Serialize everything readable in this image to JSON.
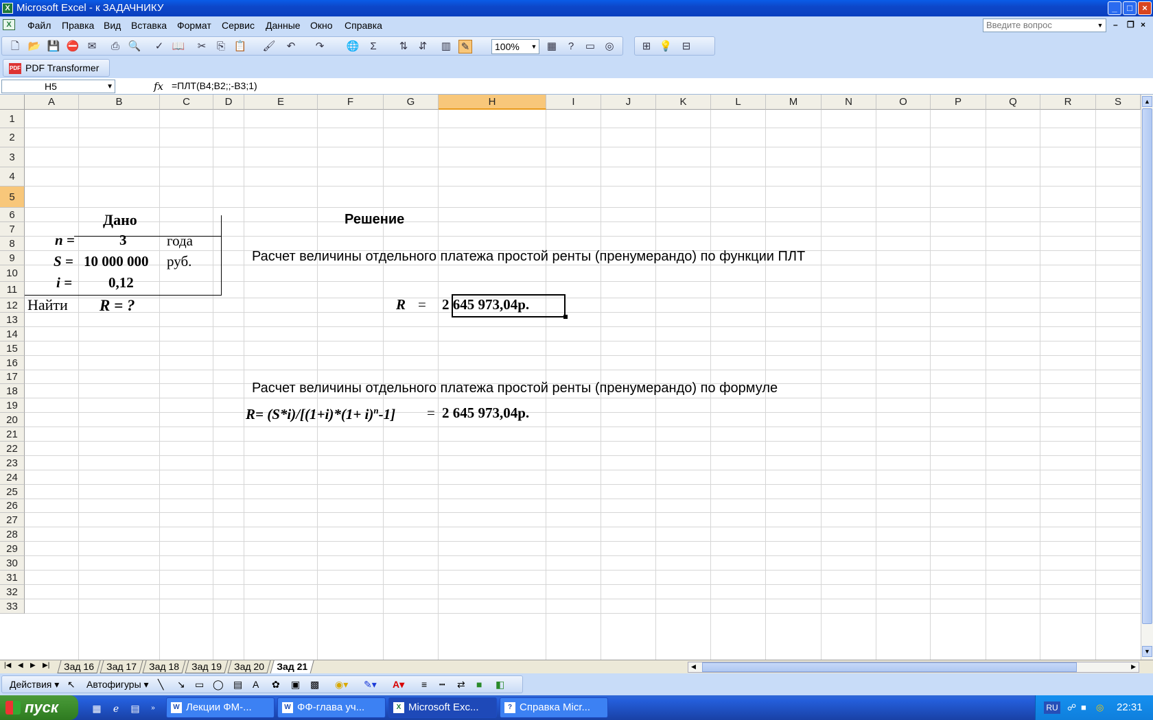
{
  "window": {
    "title": "Microsoft Excel - к ЗАДАЧНИКУ",
    "app_icon": "X"
  },
  "menu": {
    "items": [
      "Файл",
      "Правка",
      "Вид",
      "Вставка",
      "Формат",
      "Сервис",
      "Данные",
      "Окно",
      "Справка"
    ],
    "help_placeholder": "Введите вопрос"
  },
  "toolbar": {
    "zoom": "100%"
  },
  "pdf_toolbar": {
    "label": "PDF Transformer",
    "icon_text": "PDF"
  },
  "formula_bar": {
    "name_box": "H5",
    "fx": "fx",
    "formula": "=ПЛТ(B4;B2;;-B3;1)"
  },
  "grid": {
    "columns": [
      "A",
      "B",
      "C",
      "D",
      "E",
      "F",
      "G",
      "H",
      "I",
      "J",
      "K",
      "L",
      "M",
      "N",
      "O",
      "P",
      "Q",
      "R",
      "S"
    ],
    "rows": [
      "1",
      "2",
      "3",
      "4",
      "5",
      "6",
      "7",
      "8",
      "9",
      "10",
      "11",
      "12",
      "13",
      "14",
      "15",
      "16",
      "17",
      "18",
      "19",
      "20",
      "21",
      "22",
      "23",
      "24",
      "25",
      "26",
      "27",
      "28",
      "29",
      "30",
      "31",
      "32",
      "33"
    ],
    "selected_column": "H",
    "selected_row": "5"
  },
  "cells": {
    "given_title": "Дано",
    "n_label": "n =",
    "n_value": "3",
    "n_unit": "года",
    "s_label": "S =",
    "s_value": "10 000 000",
    "s_unit": "руб.",
    "i_label": "i =",
    "i_value": "0,12",
    "find_label": "Найти",
    "find_value": "R = ?",
    "solution_title": "Решение",
    "calc_plt_text": "Расчет величины отдельного платежа простой ренты (пренумерандо) по функции ПЛТ",
    "r_label": "R",
    "r_eq": "=",
    "r_value": "2 645 973,04р.",
    "calc_formula_text": "Расчет величины отдельного платежа простой ренты (пренумерандо) по формуле",
    "formula_text": "R= (S*i)/[(1+i)*(1+ i)",
    "formula_sup": "n",
    "formula_tail": "-1]",
    "formula_eq": "=",
    "formula_value": "2 645 973,04р."
  },
  "sheets": {
    "tabs": [
      "Зад 16",
      "Зад 17",
      "Зад 18",
      "Зад 19",
      "Зад 20",
      "Зад 21"
    ],
    "active": "Зад 21"
  },
  "drawing_toolbar": {
    "actions": "Действия",
    "autoshapes": "Автофигуры"
  },
  "taskbar": {
    "start": "пуск",
    "tasks": [
      "Лекции ФМ-...",
      "ФФ-глава уч...",
      "Microsoft Exc...",
      "Справка Micr..."
    ],
    "active_task": "Microsoft Exc...",
    "lang": "RU",
    "clock": "22:31"
  }
}
